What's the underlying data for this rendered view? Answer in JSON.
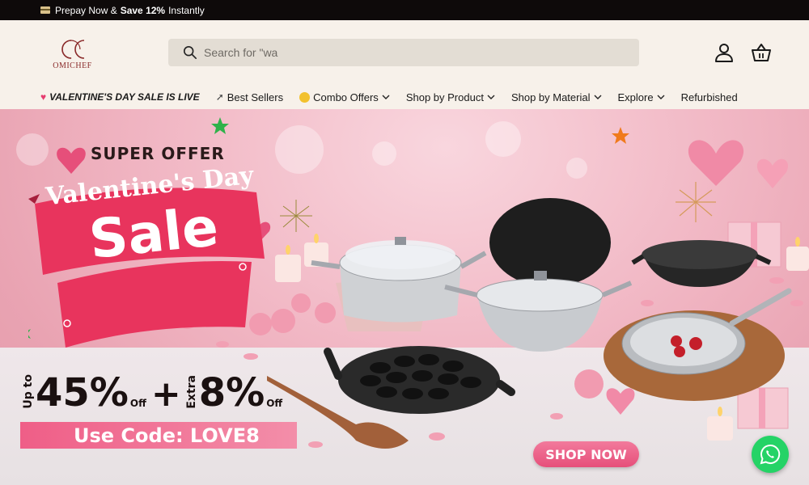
{
  "announcement": {
    "icon": "credit-card-icon",
    "prefix": "Prepay Now & ",
    "bold": "Save 12%",
    "suffix": " Instantly"
  },
  "brand": {
    "logo_text": "OMICHEF",
    "logo_color": "#8a2a2a"
  },
  "search": {
    "placeholder": "Search for \"wa"
  },
  "header_icons": [
    "account-icon",
    "cart-icon"
  ],
  "nav": {
    "items": [
      {
        "label": "VALENTINE'S DAY SALE IS LIVE",
        "icon": "heart-icon",
        "dropdown": false
      },
      {
        "label": "Best Sellers",
        "icon": "rocket-icon",
        "dropdown": false
      },
      {
        "label": "Combo Offers",
        "icon": "smile-icon",
        "dropdown": true
      },
      {
        "label": "Shop by Product",
        "dropdown": true
      },
      {
        "label": "Shop by Material",
        "dropdown": true
      },
      {
        "label": "Explore",
        "dropdown": true
      },
      {
        "label": "Refurbished",
        "dropdown": false
      }
    ]
  },
  "hero": {
    "super_offer": "SUPER OFFER",
    "title": "Valentine's Day",
    "sale": "Sale",
    "discount": {
      "up_to": "Up to",
      "primary": "45%",
      "primary_suffix": "Off",
      "plus": "+",
      "extra": "Extra",
      "secondary": "8%",
      "secondary_suffix": "Off"
    },
    "code_prefix": "Use Code: ",
    "code": "LOVE8",
    "cta": "SHOP NOW",
    "colors": {
      "accent": "#e64f7a",
      "background": "#f1b7c4"
    }
  },
  "chat": {
    "icon": "whatsapp-icon",
    "color": "#25d366"
  }
}
